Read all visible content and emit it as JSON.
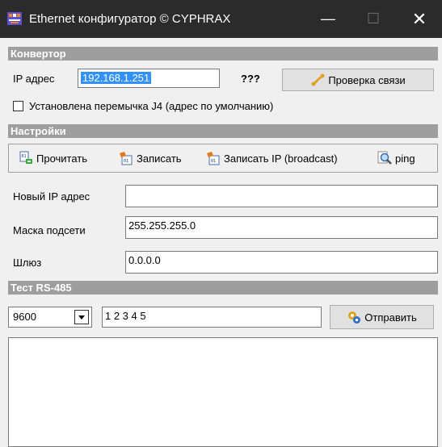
{
  "window": {
    "title": "Ethernet конфигуратор  © CYPHRAX"
  },
  "converter": {
    "section_title": "Конвертор",
    "ip_label": "IP адрес",
    "ip_value": "192.168.1.251",
    "status": "???",
    "check_button": "Проверка связи",
    "jumper_label": "Установлена перемычка J4 (адрес по умолчанию)"
  },
  "settings": {
    "section_title": "Настройки",
    "read_button": "Прочитать",
    "write_button": "Записать",
    "write_ip_button": "Записать IP (broadcast)",
    "ping_button": "ping",
    "new_ip_label": "Новый IP адрес",
    "new_ip_value": "",
    "mask_label": "Маска подсети",
    "mask_value": "255.255.255.0",
    "gateway_label": "Шлюз",
    "gateway_value": "0.0.0.0"
  },
  "rs485": {
    "section_title": "Тест RS-485",
    "baud_value": "9600",
    "data_value": "1 2 3 4 5",
    "send_button": "Отправить",
    "log_value": ""
  }
}
